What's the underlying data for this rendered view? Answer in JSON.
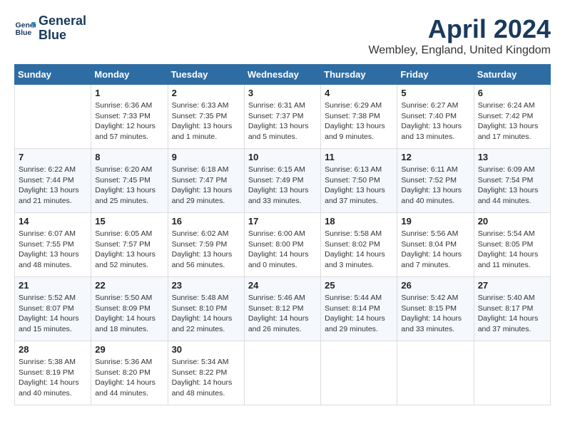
{
  "header": {
    "logo_line1": "General",
    "logo_line2": "Blue",
    "month_year": "April 2024",
    "location": "Wembley, England, United Kingdom"
  },
  "days_of_week": [
    "Sunday",
    "Monday",
    "Tuesday",
    "Wednesday",
    "Thursday",
    "Friday",
    "Saturday"
  ],
  "weeks": [
    [
      {
        "day": "",
        "info": ""
      },
      {
        "day": "1",
        "info": "Sunrise: 6:36 AM\nSunset: 7:33 PM\nDaylight: 12 hours\nand 57 minutes."
      },
      {
        "day": "2",
        "info": "Sunrise: 6:33 AM\nSunset: 7:35 PM\nDaylight: 13 hours\nand 1 minute."
      },
      {
        "day": "3",
        "info": "Sunrise: 6:31 AM\nSunset: 7:37 PM\nDaylight: 13 hours\nand 5 minutes."
      },
      {
        "day": "4",
        "info": "Sunrise: 6:29 AM\nSunset: 7:38 PM\nDaylight: 13 hours\nand 9 minutes."
      },
      {
        "day": "5",
        "info": "Sunrise: 6:27 AM\nSunset: 7:40 PM\nDaylight: 13 hours\nand 13 minutes."
      },
      {
        "day": "6",
        "info": "Sunrise: 6:24 AM\nSunset: 7:42 PM\nDaylight: 13 hours\nand 17 minutes."
      }
    ],
    [
      {
        "day": "7",
        "info": "Sunrise: 6:22 AM\nSunset: 7:44 PM\nDaylight: 13 hours\nand 21 minutes."
      },
      {
        "day": "8",
        "info": "Sunrise: 6:20 AM\nSunset: 7:45 PM\nDaylight: 13 hours\nand 25 minutes."
      },
      {
        "day": "9",
        "info": "Sunrise: 6:18 AM\nSunset: 7:47 PM\nDaylight: 13 hours\nand 29 minutes."
      },
      {
        "day": "10",
        "info": "Sunrise: 6:15 AM\nSunset: 7:49 PM\nDaylight: 13 hours\nand 33 minutes."
      },
      {
        "day": "11",
        "info": "Sunrise: 6:13 AM\nSunset: 7:50 PM\nDaylight: 13 hours\nand 37 minutes."
      },
      {
        "day": "12",
        "info": "Sunrise: 6:11 AM\nSunset: 7:52 PM\nDaylight: 13 hours\nand 40 minutes."
      },
      {
        "day": "13",
        "info": "Sunrise: 6:09 AM\nSunset: 7:54 PM\nDaylight: 13 hours\nand 44 minutes."
      }
    ],
    [
      {
        "day": "14",
        "info": "Sunrise: 6:07 AM\nSunset: 7:55 PM\nDaylight: 13 hours\nand 48 minutes."
      },
      {
        "day": "15",
        "info": "Sunrise: 6:05 AM\nSunset: 7:57 PM\nDaylight: 13 hours\nand 52 minutes."
      },
      {
        "day": "16",
        "info": "Sunrise: 6:02 AM\nSunset: 7:59 PM\nDaylight: 13 hours\nand 56 minutes."
      },
      {
        "day": "17",
        "info": "Sunrise: 6:00 AM\nSunset: 8:00 PM\nDaylight: 14 hours\nand 0 minutes."
      },
      {
        "day": "18",
        "info": "Sunrise: 5:58 AM\nSunset: 8:02 PM\nDaylight: 14 hours\nand 3 minutes."
      },
      {
        "day": "19",
        "info": "Sunrise: 5:56 AM\nSunset: 8:04 PM\nDaylight: 14 hours\nand 7 minutes."
      },
      {
        "day": "20",
        "info": "Sunrise: 5:54 AM\nSunset: 8:05 PM\nDaylight: 14 hours\nand 11 minutes."
      }
    ],
    [
      {
        "day": "21",
        "info": "Sunrise: 5:52 AM\nSunset: 8:07 PM\nDaylight: 14 hours\nand 15 minutes."
      },
      {
        "day": "22",
        "info": "Sunrise: 5:50 AM\nSunset: 8:09 PM\nDaylight: 14 hours\nand 18 minutes."
      },
      {
        "day": "23",
        "info": "Sunrise: 5:48 AM\nSunset: 8:10 PM\nDaylight: 14 hours\nand 22 minutes."
      },
      {
        "day": "24",
        "info": "Sunrise: 5:46 AM\nSunset: 8:12 PM\nDaylight: 14 hours\nand 26 minutes."
      },
      {
        "day": "25",
        "info": "Sunrise: 5:44 AM\nSunset: 8:14 PM\nDaylight: 14 hours\nand 29 minutes."
      },
      {
        "day": "26",
        "info": "Sunrise: 5:42 AM\nSunset: 8:15 PM\nDaylight: 14 hours\nand 33 minutes."
      },
      {
        "day": "27",
        "info": "Sunrise: 5:40 AM\nSunset: 8:17 PM\nDaylight: 14 hours\nand 37 minutes."
      }
    ],
    [
      {
        "day": "28",
        "info": "Sunrise: 5:38 AM\nSunset: 8:19 PM\nDaylight: 14 hours\nand 40 minutes."
      },
      {
        "day": "29",
        "info": "Sunrise: 5:36 AM\nSunset: 8:20 PM\nDaylight: 14 hours\nand 44 minutes."
      },
      {
        "day": "30",
        "info": "Sunrise: 5:34 AM\nSunset: 8:22 PM\nDaylight: 14 hours\nand 48 minutes."
      },
      {
        "day": "",
        "info": ""
      },
      {
        "day": "",
        "info": ""
      },
      {
        "day": "",
        "info": ""
      },
      {
        "day": "",
        "info": ""
      }
    ]
  ]
}
